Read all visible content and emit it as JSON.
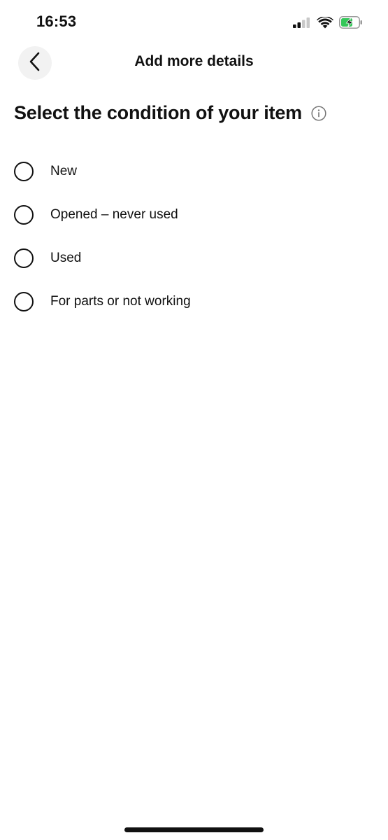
{
  "status_bar": {
    "time": "16:53",
    "icons": [
      "cellular-signal-icon",
      "wifi-icon",
      "battery-charging-icon"
    ],
    "battery_color": "#34c759"
  },
  "header": {
    "title": "Add more details",
    "back_icon": "chevron-left-icon"
  },
  "section": {
    "heading": "Select the condition of your item",
    "info_icon": "info-icon"
  },
  "options": [
    {
      "label": "New",
      "selected": false
    },
    {
      "label": "Opened – never used",
      "selected": false
    },
    {
      "label": "Used",
      "selected": false
    },
    {
      "label": "For parts or not working",
      "selected": false
    }
  ],
  "colors": {
    "text": "#111111",
    "back_button_bg": "#f2f2f2",
    "info_icon": "#767676"
  }
}
